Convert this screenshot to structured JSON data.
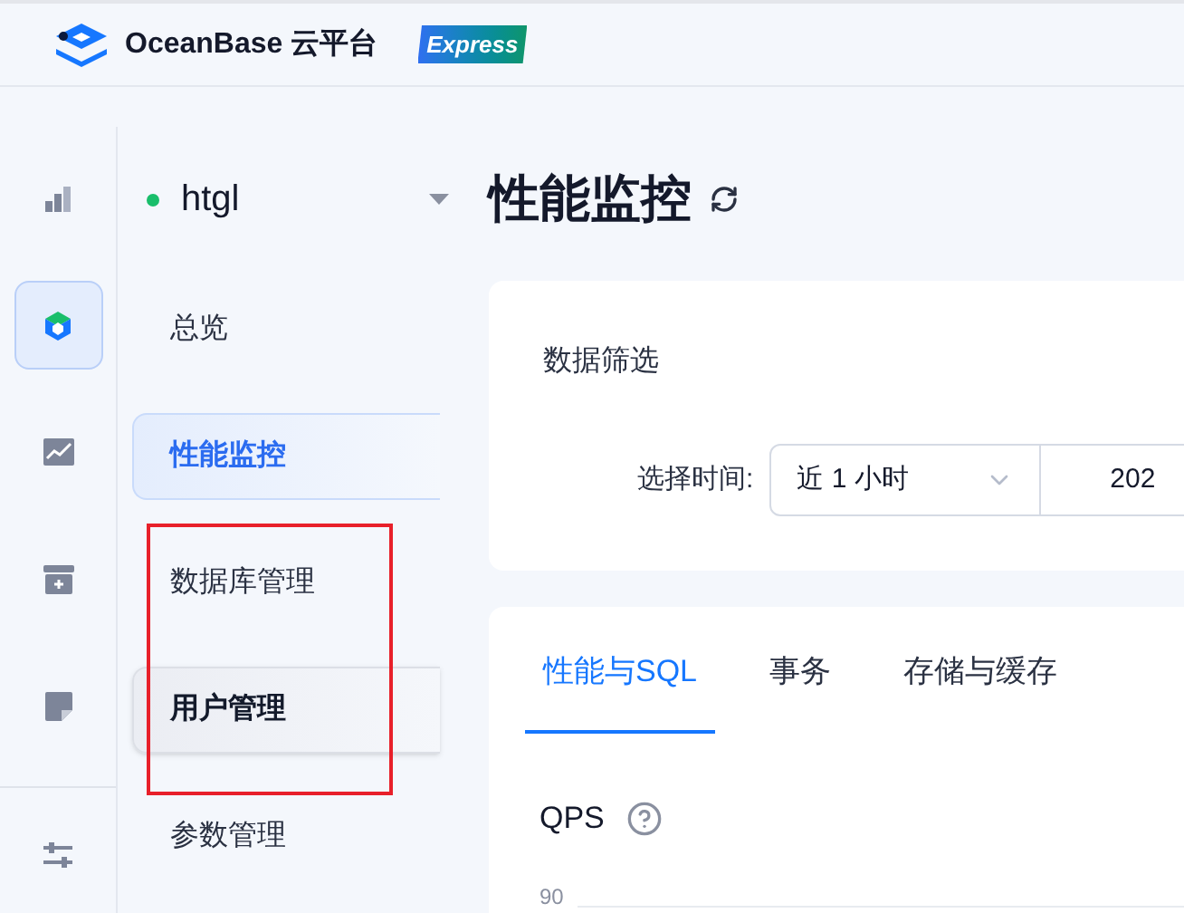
{
  "header": {
    "brand": "OceanBase 云平台",
    "badge": "Express"
  },
  "rail": [
    {
      "kind": "bars",
      "selected": false
    },
    {
      "kind": "cube",
      "selected": true
    },
    {
      "kind": "trend",
      "selected": false
    },
    {
      "kind": "box",
      "selected": false
    },
    {
      "kind": "note",
      "selected": false
    }
  ],
  "rail_footer": {
    "kind": "sliders"
  },
  "instance": {
    "name": "htgl",
    "color": "#19be6b"
  },
  "nav": [
    {
      "label": "总览",
      "selected": false,
      "hovered": false,
      "highlighted": false
    },
    {
      "label": "性能监控",
      "selected": true,
      "hovered": false,
      "highlighted": false
    },
    {
      "label": "数据库管理",
      "selected": false,
      "hovered": false,
      "highlighted": true
    },
    {
      "label": "用户管理",
      "selected": false,
      "hovered": true,
      "highlighted": true
    },
    {
      "label": "参数管理",
      "selected": false,
      "hovered": false,
      "highlighted": false
    }
  ],
  "page_title": "性能监控",
  "filter": {
    "title": "数据筛选",
    "label": "选择时间:",
    "range": "近 1 小时",
    "start": "202"
  },
  "tabs": [
    {
      "label": "性能与SQL",
      "selected": true
    },
    {
      "label": "事务",
      "selected": false
    },
    {
      "label": "存储与缓存",
      "selected": false
    }
  ],
  "qps": {
    "title": "QPS",
    "axis_label": "90"
  }
}
